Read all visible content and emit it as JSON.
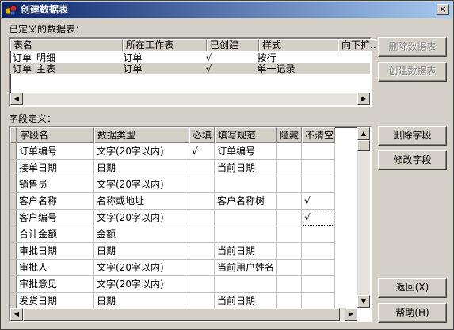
{
  "window": {
    "title": "创建数据表",
    "close_glyph": "×"
  },
  "defined_tables": {
    "label": "已定义的数据表：",
    "columns": [
      "表名",
      "所在工作表",
      "已创建",
      "样式",
      "向下扩..."
    ],
    "rows": [
      [
        "订单_明细",
        "订单",
        "√",
        "按行",
        ""
      ],
      [
        "订单_主表",
        "订单",
        "√",
        "单一记录",
        ""
      ]
    ],
    "selected_row": 1
  },
  "table_buttons": {
    "delete_table": "删除数据表",
    "create_table": "创建数据表"
  },
  "fields": {
    "label": "字段定义：",
    "columns": [
      "字段名",
      "数据类型",
      "必填",
      "填写规范",
      "隐藏",
      "不清空"
    ],
    "rows": [
      [
        "订单编号",
        "文字(20字以内)",
        "√",
        "订单编号",
        "",
        ""
      ],
      [
        "接单日期",
        "日期",
        "",
        "当前日期",
        "",
        ""
      ],
      [
        "销售员",
        "文字(20字以内)",
        "",
        "",
        "",
        ""
      ],
      [
        "客户名称",
        "名称或地址",
        "",
        "客户名称树",
        "",
        "√"
      ],
      [
        "客户编号",
        "文字(20字以内)",
        "",
        "",
        "",
        "√"
      ],
      [
        "合计金额",
        "金额",
        "",
        "",
        "",
        ""
      ],
      [
        "审批日期",
        "日期",
        "",
        "当前日期",
        "",
        ""
      ],
      [
        "审批人",
        "文字(20字以内)",
        "",
        "当前用户姓名",
        "",
        ""
      ],
      [
        "审批意见",
        "文字(20字以内)",
        "",
        "",
        "",
        ""
      ],
      [
        "发货日期",
        "日期",
        "",
        "当前日期",
        "",
        ""
      ]
    ]
  },
  "field_buttons": {
    "delete_field": "删除字段",
    "edit_field": "修改字段",
    "back": "返回(X)",
    "help": "帮助(H)"
  },
  "icons": {
    "scroll_left": "◀",
    "scroll_right": "▶",
    "scroll_up": "▲",
    "scroll_down": "▼"
  }
}
